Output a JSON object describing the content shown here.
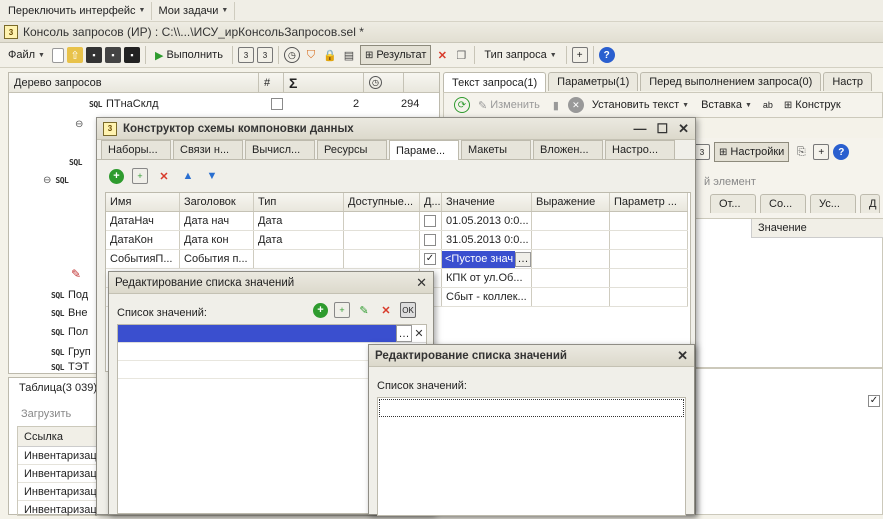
{
  "menubar": {
    "items": [
      {
        "label": "Переключить интерфейс"
      },
      {
        "label": "Мои задачи"
      }
    ]
  },
  "window": {
    "title": "Консоль запросов (ИР) : С:\\\\...\\ИСУ_ирКонсольЗапросов.sel *"
  },
  "toolbar": {
    "file_label": "Файл",
    "run_label": "Выполнить",
    "result_label": "Результат",
    "query_type_label": "Тип запроса"
  },
  "tree": {
    "title": "Дерево запросов",
    "col_hash": "#",
    "col_sum": "Σ",
    "rows": [
      {
        "name": "ПТнаСклд",
        "count": "2",
        "time": "294"
      },
      {
        "name": "Под"
      },
      {
        "name": "Вне"
      },
      {
        "name": "Пол"
      },
      {
        "name": "Груп"
      },
      {
        "name": "ТЭТ"
      }
    ]
  },
  "right_tabs": [
    {
      "label": "Текст запроса(1)"
    },
    {
      "label": "Параметры(1)"
    },
    {
      "label": "Перед выполнением запроса(0)"
    },
    {
      "label": "Настр"
    }
  ],
  "right_toolbar": {
    "change_label": "Изменить",
    "set_text_label": "Установить текст",
    "insert_label": "Вставка",
    "constructor_label": "Конструк"
  },
  "right_partial": {
    "settings_label": "Настройки",
    "element_label": "й элемент",
    "subtabs": [
      "От...",
      "Со...",
      "Ус...",
      "Д"
    ],
    "value_header": "Значение"
  },
  "bottom": {
    "table_label": "Таблица(3 039)",
    "load_label": "Загрузить",
    "col_link": "Ссылка",
    "rows": [
      "Инвентаризац",
      "Инвентаризац",
      "Инвентаризац",
      "Инвентаризац"
    ]
  },
  "constructor": {
    "title": "Конструктор схемы компоновки данных",
    "tabs": [
      "Наборы...",
      "Связи н...",
      "Вычисл...",
      "Ресурсы",
      "Параме...",
      "Макеты",
      "Вложен...",
      "Настро..."
    ],
    "columns": [
      "Имя",
      "Заголовок",
      "Тип",
      "Доступные...",
      "Д...",
      "Значение",
      "Выражение",
      "Параметр ..."
    ],
    "rows": [
      {
        "name": "ДатаНач",
        "title": "Дата нач",
        "type": "Дата",
        "value": "01.05.2013 0:0..."
      },
      {
        "name": "ДатаКон",
        "title": "Дата кон",
        "type": "Дата",
        "value": "31.05.2013 0:0..."
      },
      {
        "name": "СобытияП...",
        "title": "События п...",
        "type": "",
        "value": "<Пустое знач"
      },
      {
        "name": "",
        "title": "",
        "type": "",
        "value": "КПК от ул.Об..."
      },
      {
        "name": "",
        "title": "",
        "type": "",
        "value": "Сбыт - коллек..."
      }
    ]
  },
  "list_dialog_1": {
    "title": "Редактирование списка значений",
    "label": "Список значений:"
  },
  "list_dialog_2": {
    "title": "Редактирование списка значений",
    "label": "Список значений:"
  },
  "colors": {
    "selection": "#3a4fcf",
    "accent_green": "#2e9b2e",
    "red_x": "#d83a2a"
  }
}
